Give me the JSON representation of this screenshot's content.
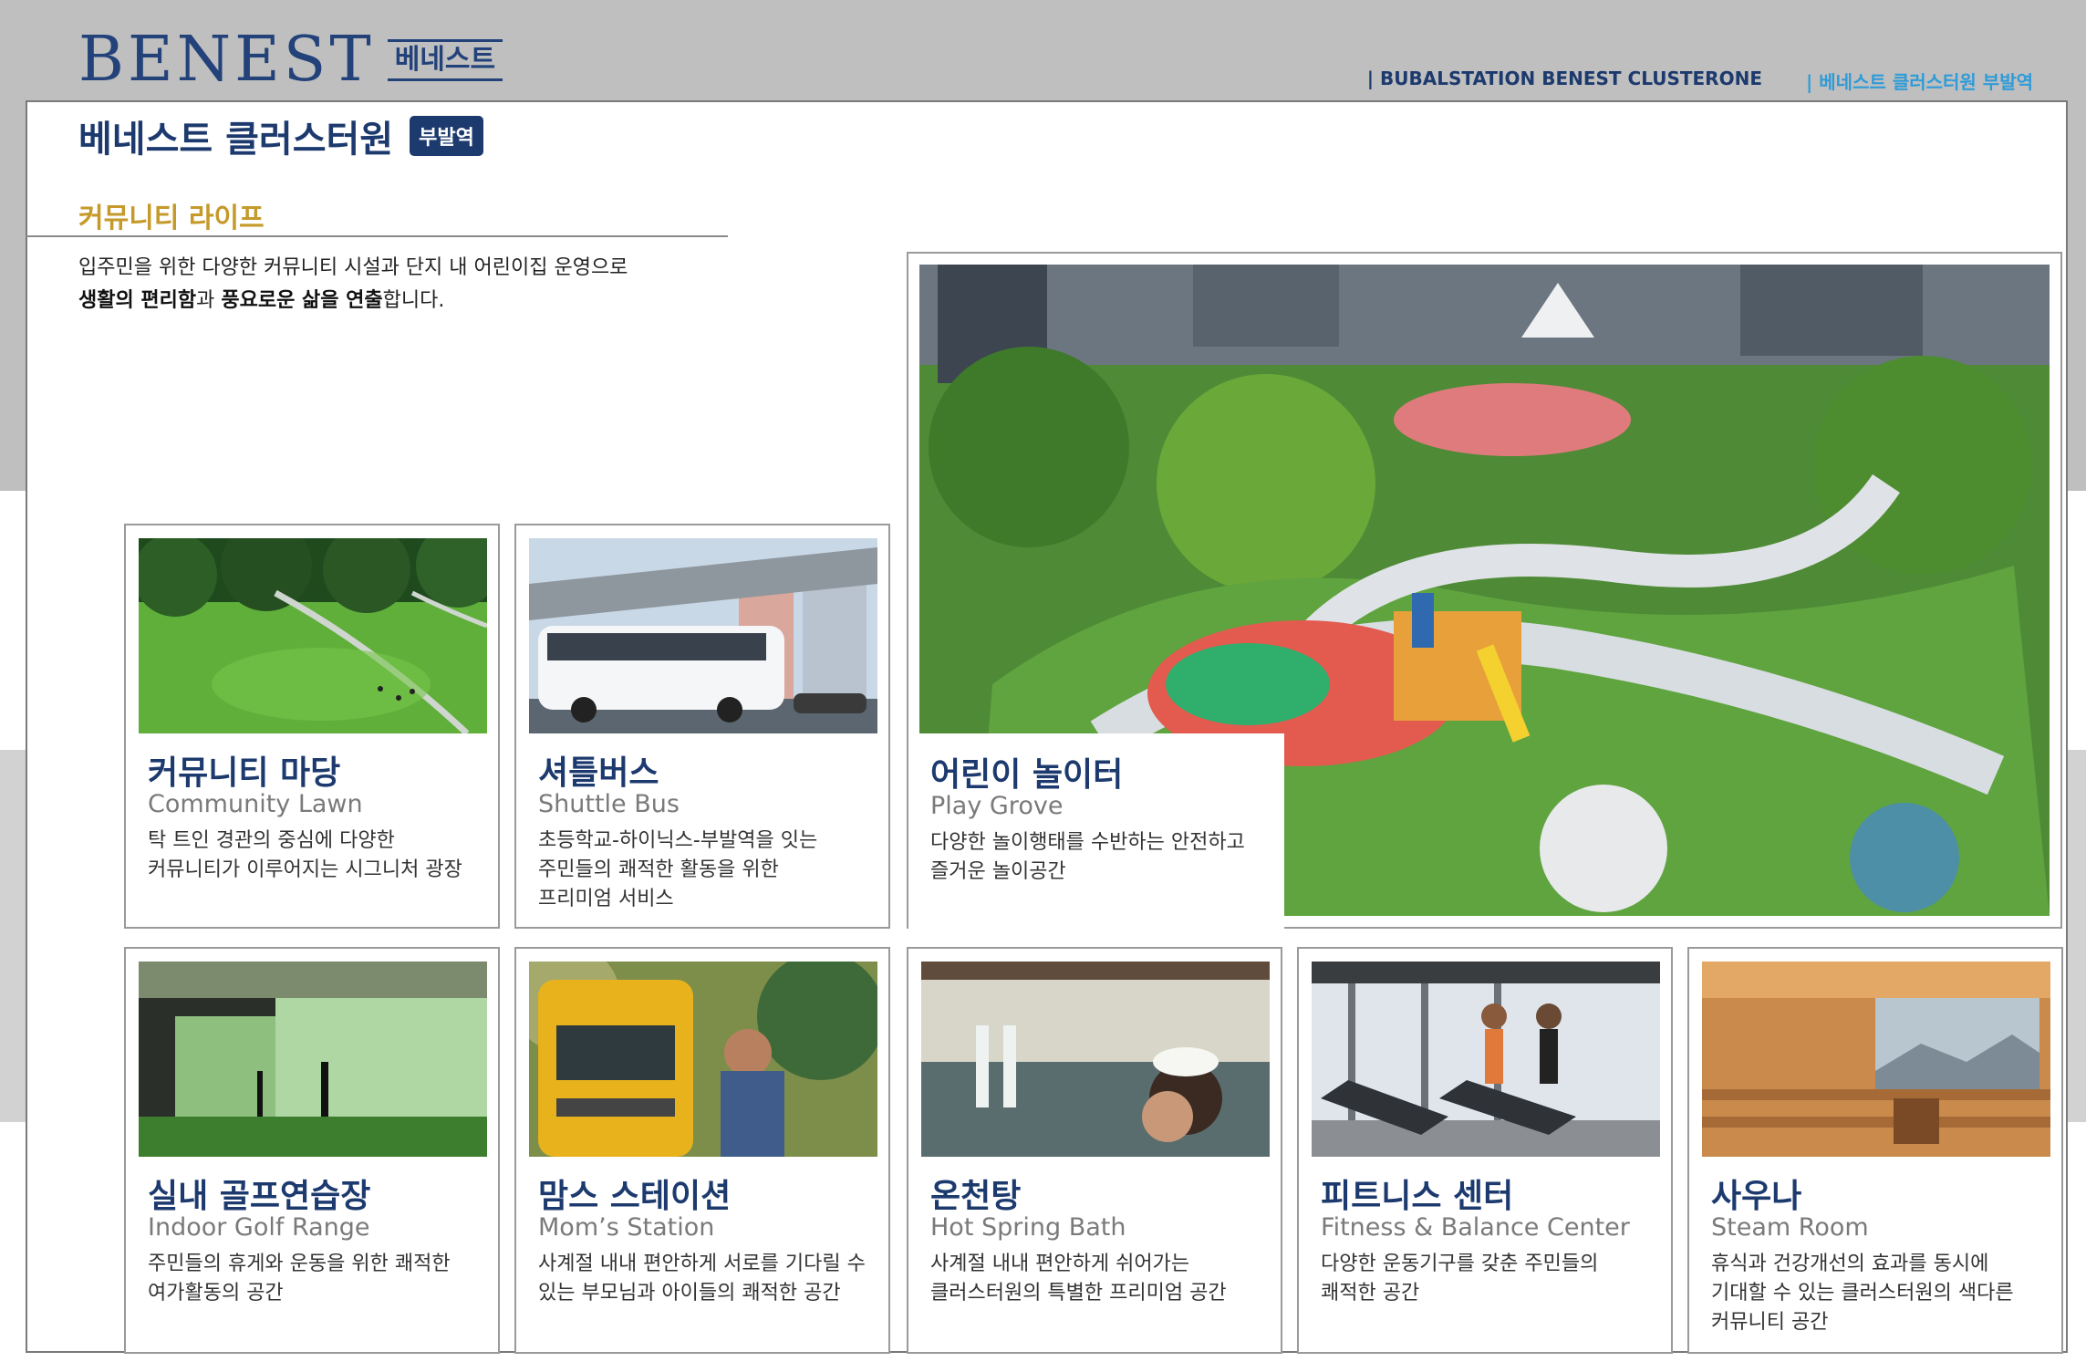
{
  "brand": {
    "name_en": "BENEST",
    "name_ko": "베네스트"
  },
  "header": {
    "right_en": "BUBALSTATION BENEST CLUSTERONE",
    "right_ko": "베네스트 클러스터원 부발역"
  },
  "page": {
    "title": "베네스트 클러스터원",
    "badge": "부발역",
    "section": "커뮤니티 라이프",
    "intro_line1": "입주민을 위한 다양한 커뮤니티 시설과 단지 내 어린이집 운영으로",
    "intro_b1": "생활의 편리함",
    "intro_mid": "과 ",
    "intro_b2": "풍요로운 삶을 연출",
    "intro_end": "합니다."
  },
  "cards": [
    {
      "ko": "커뮤니티 마당",
      "en": "Community Lawn",
      "desc": [
        "탁 트인 경관의 중심에 다양한",
        "커뮤니티가 이루어지는 시그니처 광장"
      ]
    },
    {
      "ko": "셔틀버스",
      "en": "Shuttle Bus",
      "desc": [
        "초등학교-하이닉스-부발역을 잇는",
        "주민들의 쾌적한 활동을 위한",
        "프리미엄 서비스"
      ]
    },
    {
      "ko": "어린이 놀이터",
      "en": "Play Grove",
      "desc": [
        "다양한 놀이행태를 수반하는 안전하고",
        "즐거운 놀이공간"
      ]
    },
    {
      "ko": "실내 골프연습장",
      "en": "Indoor Golf Range",
      "desc": [
        "주민들의 휴게와 운동을 위한 쾌적한",
        "여가활동의 공간"
      ]
    },
    {
      "ko": "맘스 스테이션",
      "en": "Mom’s Station",
      "desc": [
        "사계절 내내 편안하게 서로를 기다릴 수",
        "있는 부모님과 아이들의 쾌적한 공간"
      ]
    },
    {
      "ko": "온천탕",
      "en": "Hot Spring Bath",
      "desc": [
        "사계절 내내 편안하게 쉬어가는",
        "클러스터원의 특별한 프리미엄 공간"
      ]
    },
    {
      "ko": "피트니스 센터",
      "en": "Fitness & Balance Center",
      "desc": [
        "다양한 운동기구를 갖춘 주민들의",
        "쾌적한 공간"
      ]
    },
    {
      "ko": "사우나",
      "en": "Steam Room",
      "desc": [
        "휴식과 건강개선의 효과를 동시에",
        "기대할 수 있는 클러스터원의 색다른",
        "커뮤니티 공간"
      ]
    }
  ],
  "colors": {
    "navy": "#1d3a6e",
    "gold": "#c59a2b",
    "sky": "#2f9bd8",
    "grey_band": "#bfbfbf"
  }
}
